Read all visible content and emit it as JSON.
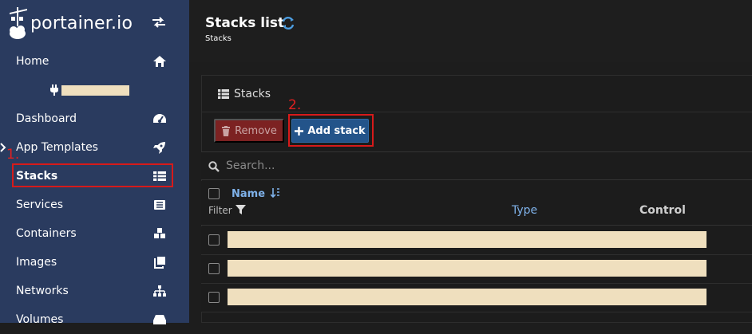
{
  "app": {
    "logo_text": "portainer.io"
  },
  "sidebar": {
    "items": [
      {
        "label": "Home",
        "icon": "home-icon"
      },
      {
        "label": "Dashboard",
        "icon": "tachometer-icon"
      },
      {
        "label": "App Templates",
        "icon": "rocket-icon"
      },
      {
        "label": "Stacks",
        "icon": "th-list-icon"
      },
      {
        "label": "Services",
        "icon": "list-alt-icon"
      },
      {
        "label": "Containers",
        "icon": "cubes-icon"
      },
      {
        "label": "Images",
        "icon": "clone-icon"
      },
      {
        "label": "Networks",
        "icon": "sitemap-icon"
      },
      {
        "label": "Volumes",
        "icon": "hdd-icon"
      }
    ],
    "active": "Stacks"
  },
  "header": {
    "title": "Stacks list",
    "breadcrumb": "Stacks"
  },
  "panel": {
    "title": "Stacks",
    "remove_label": "Remove",
    "add_label": "Add stack",
    "search_placeholder": "Search...",
    "columns": {
      "name": "Name",
      "filter": "Filter",
      "type": "Type",
      "control": "Control"
    },
    "row_count": 3
  },
  "annotations": {
    "step1": "1.",
    "step2": "2."
  },
  "colors": {
    "sidebar": "#2a3b5f",
    "accent": "#23548a",
    "danger": "#7c2222",
    "annotation": "#d71a1a"
  }
}
